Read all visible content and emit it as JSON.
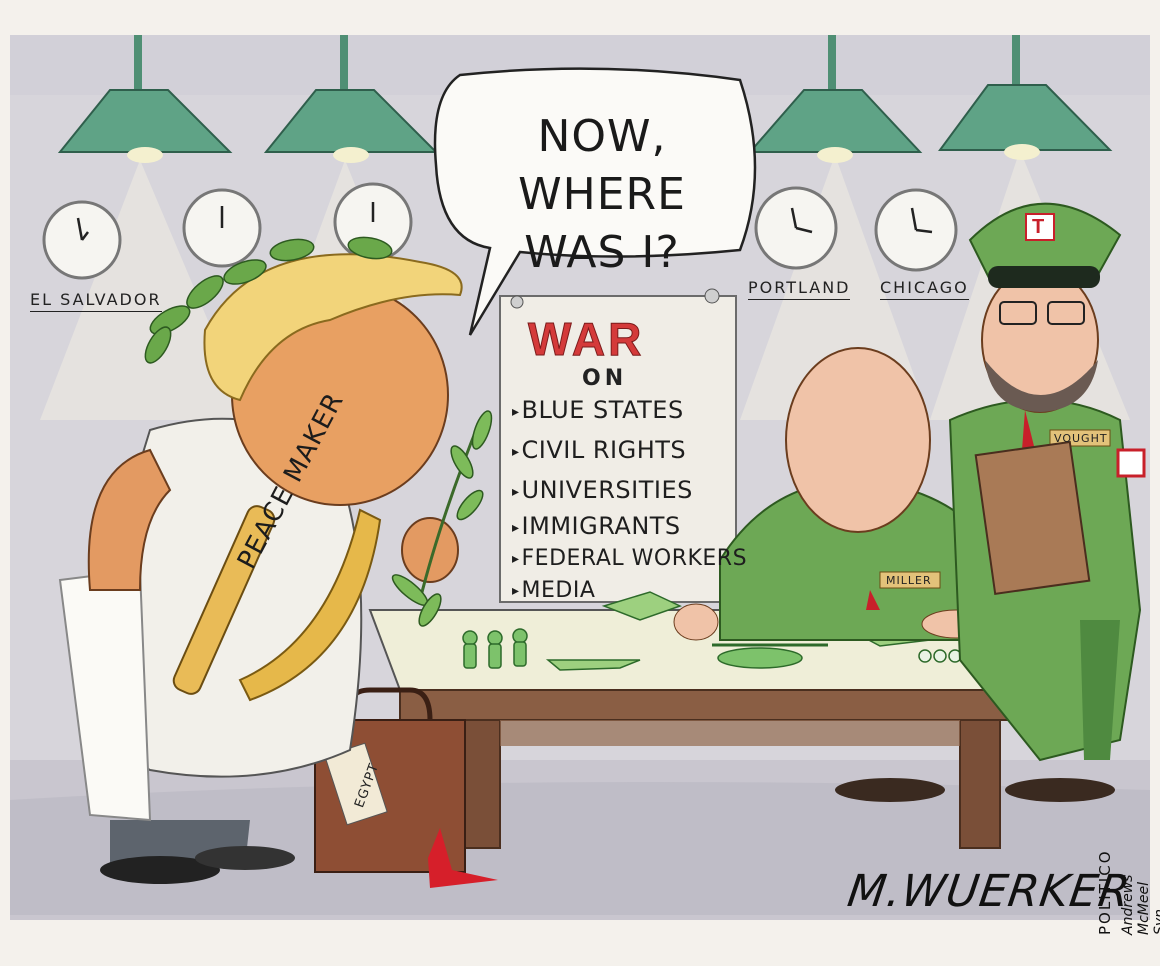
{
  "speech_bubble": {
    "line1": "NOW, WHERE",
    "line2": "WAS I?"
  },
  "poster": {
    "title": "WAR",
    "subtitle": "ON",
    "items": [
      "BLUE STATES",
      "CIVIL RIGHTS",
      "UNIVERSITIES",
      "IMMIGRANTS",
      "FEDERAL WORKERS",
      "MEDIA"
    ]
  },
  "clock_labels": {
    "left": "EL SALVADOR",
    "portland": "PORTLAND",
    "chicago": "CHICAGO"
  },
  "sash_text": "PEACE MAKER",
  "suitcase_tag": "EGYPT",
  "name_tag": "MILLER",
  "vought_tag": "VOUGHT",
  "cap_letter": "T",
  "signature": "M.WUERKER",
  "credits": {
    "outlet": "POLITICO",
    "syndicate": "Andrews McMeel Syn."
  },
  "colors": {
    "wall": "#d8d6dc",
    "lamp_green": "#5a9e82",
    "uniform_green": "#6da855",
    "table_top": "#f0efdc",
    "table_wood": "#8a5e44",
    "toga": "#f2f0ea",
    "sash_gold": "#e6b84a",
    "war_red": "#d43a3a",
    "skin_orange": "#e8a062"
  }
}
